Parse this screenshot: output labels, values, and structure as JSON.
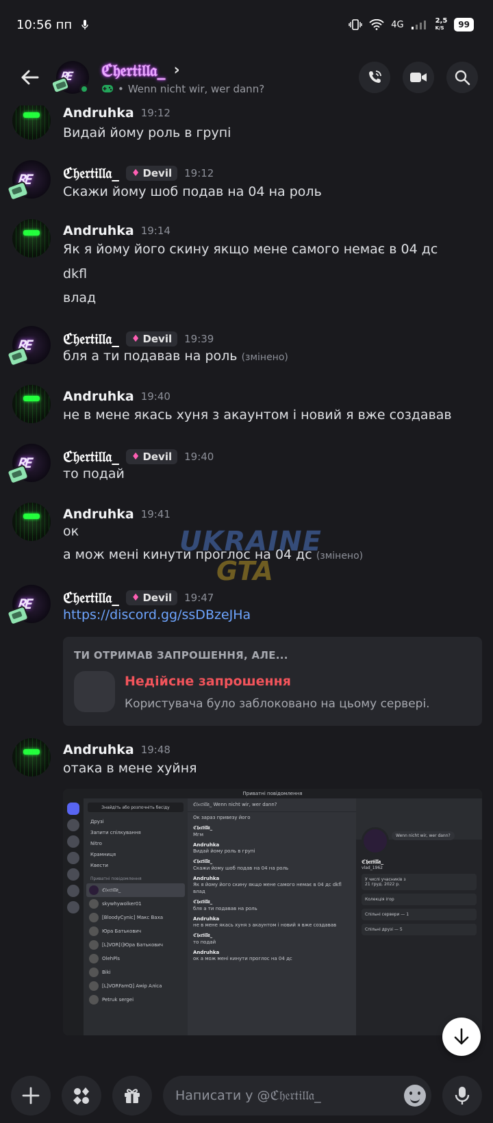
{
  "status_bar": {
    "time": "10:56 пп",
    "network": "4G",
    "speed": "2,5",
    "speed_unit": "K/S",
    "battery": "99"
  },
  "header": {
    "name": "ℭ𝔥𝔢𝔯𝔱𝔦𝔩𝔩𝔞_",
    "status_text": "Wenn nicht wir, wer dann?",
    "icons": [
      "back-arrow-icon",
      "phone-icon",
      "video-icon",
      "search-icon"
    ]
  },
  "messages": [
    {
      "author": "Andruhka",
      "time": "19:12",
      "lines": [
        "Видай йому роль в групі"
      ]
    },
    {
      "author": "ℭ𝔥𝔢𝔯𝔱𝔦𝔩𝔩𝔞_",
      "tag": "Devil",
      "time": "19:12",
      "lines": [
        "Скажи йому шоб подав на 04 на роль"
      ]
    },
    {
      "author": "Andruhka",
      "time": "19:14",
      "lines": [
        "Як я йому його скину якщо мене самого немає в 04 дс",
        "dkfl",
        "влад"
      ]
    },
    {
      "author": "ℭ𝔥𝔢𝔯𝔱𝔦𝔩𝔩𝔞_",
      "tag": "Devil",
      "time": "19:39",
      "lines": [
        "бля а ти подавав на роль"
      ],
      "edited": "(змінено)"
    },
    {
      "author": "Andruhka",
      "time": "19:40",
      "lines": [
        "не в мене якась хуня з акаунтом і новий я вже создавав"
      ]
    },
    {
      "author": "ℭ𝔥𝔢𝔯𝔱𝔦𝔩𝔩𝔞_",
      "tag": "Devil",
      "time": "19:40",
      "lines": [
        "то подай"
      ]
    },
    {
      "author": "Andruhka",
      "time": "19:41",
      "lines": [
        "ок",
        "а мож мені кинути проглос на 04 дс"
      ],
      "edited": "(змінено)"
    },
    {
      "author": "ℭ𝔥𝔢𝔯𝔱𝔦𝔩𝔩𝔞_",
      "tag": "Devil",
      "time": "19:47",
      "link": "https://discord.gg/ssDBzeJHa"
    },
    {
      "author": "Andruhka",
      "time": "19:48",
      "lines": [
        "отака в мене хуйня"
      ]
    }
  ],
  "invite": {
    "title": "ТИ ОТРИМАВ ЗАПРОШЕННЯ, АЛЕ...",
    "name": "Недійсне запрошення",
    "description": "Користувача було заблоковано на цьому сервері."
  },
  "attachment": {
    "window_title": "Приватні повідомлення",
    "search": "Знайдіть або розпочніть бесіду",
    "nav": [
      "Друзі",
      "Запити спілкування",
      "Nitro",
      "Крамниця",
      "Квести"
    ],
    "dm_header": "Приватні повідомлення",
    "dms": [
      "ℭ𝔥𝔢𝔯𝔱𝔦𝔩𝔩𝔞_",
      "skywhywolker01",
      "[BloodyCynic] Макс Ваха",
      "Юра Батькович",
      "[L]VOR[I]Юра Батькович",
      "OlehPls",
      "Biki",
      "[L]VORFamQ] Амір Аліса",
      "Petruk sergei"
    ],
    "chat_header": "ℭ𝔥𝔢𝔯𝔱𝔦𝔩𝔩𝔞_  Wenn nicht wir, wer dann?",
    "chat": [
      {
        "n": "",
        "t": "Ок зараз привезу його"
      },
      {
        "n": "ℭ𝔥𝔢𝔯𝔱𝔦𝔩𝔩𝔞_",
        "t": "Мгм"
      },
      {
        "n": "Andruhka",
        "t": "Видай йому роль в групі"
      },
      {
        "n": "ℭ𝔥𝔢𝔯𝔱𝔦𝔩𝔩𝔞_",
        "t": "Скажи йому шоб подав на 04 на роль"
      },
      {
        "n": "Andruhka",
        "t": "Як я йому його скину якщо мене самого немає в 04 дс dkfl влад"
      },
      {
        "n": "ℭ𝔥𝔢𝔯𝔱𝔦𝔩𝔩𝔞_",
        "t": "бля а ти подавав на роль"
      },
      {
        "n": "Andruhka",
        "t": "не в мене якась хуня з акаунтом і новий я вже создавав"
      },
      {
        "n": "ℭ𝔥𝔢𝔯𝔱𝔦𝔩𝔩𝔞_",
        "t": "то подай"
      },
      {
        "n": "Andruhka",
        "t": "ок а мож мені кинути проглос на 04 дс"
      }
    ],
    "profile": {
      "bubble": "Wenn nicht wir, wer dann?",
      "name": "ℭ𝔥𝔢𝔯𝔱𝔦𝔩𝔩𝔞_",
      "handle": "vlad_1962",
      "member_label": "У числі учасників з",
      "member_since": "21 груд. 2022 р.",
      "collection": "Колекція ігор",
      "shared_servers": "Спільні сервери — 1",
      "shared_friends": "Спільні друзі — 5"
    }
  },
  "watermark": {
    "line1": "UKRAINE",
    "line2": "GTA"
  },
  "composer": {
    "placeholder": "Написати у @ℭ𝔥𝔢𝔯𝔱𝔦𝔩𝔩𝔞_",
    "icons": [
      "plus-icon",
      "apps-icon",
      "gift-icon",
      "emoji-icon",
      "microphone-icon"
    ]
  },
  "colors": {
    "background": "#1a1a1e",
    "link": "#6ea5ff",
    "error": "#f2545b",
    "tag_gem": "#ff5fb4"
  }
}
